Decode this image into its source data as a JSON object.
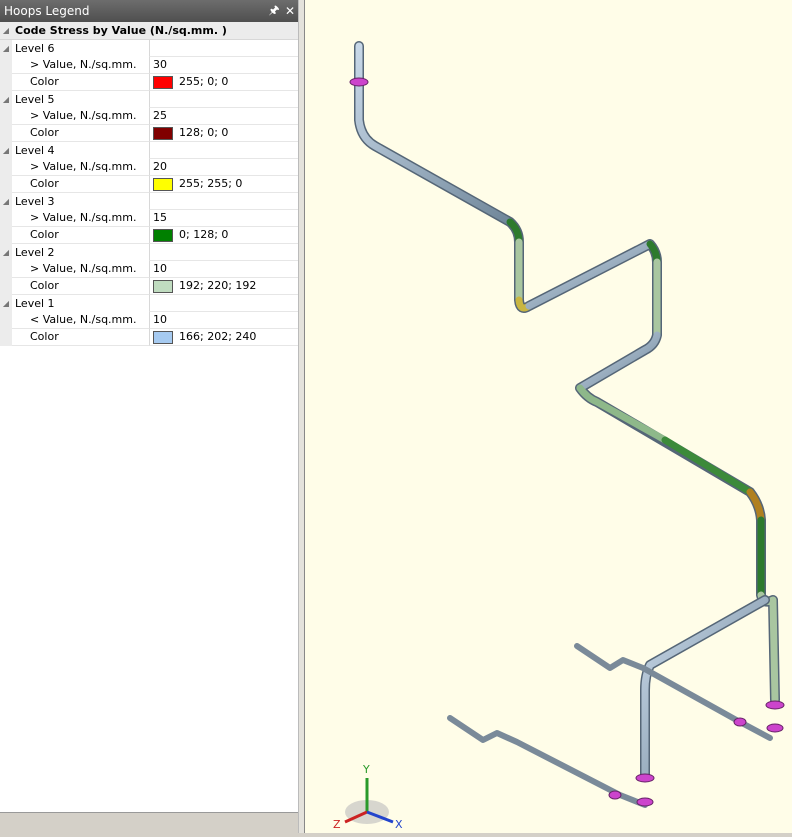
{
  "panel": {
    "title": "Hoops Legend",
    "pin_icon": "pin-icon",
    "close_icon": "close-icon",
    "header": "Code Stress by Value (N./sq.mm. )",
    "levels": [
      {
        "name": "Level 6",
        "cmp_label": "> Value, N./sq.mm.",
        "value": "30",
        "color_label": "Color",
        "color_text": "255; 0; 0",
        "color": "#ff0000"
      },
      {
        "name": "Level 5",
        "cmp_label": "> Value, N./sq.mm.",
        "value": "25",
        "color_label": "Color",
        "color_text": "128; 0; 0",
        "color": "#800000"
      },
      {
        "name": "Level 4",
        "cmp_label": "> Value, N./sq.mm.",
        "value": "20",
        "color_label": "Color",
        "color_text": "255; 255; 0",
        "color": "#ffff00"
      },
      {
        "name": "Level 3",
        "cmp_label": "> Value, N./sq.mm.",
        "value": "15",
        "color_label": "Color",
        "color_text": "0; 128; 0",
        "color": "#008000"
      },
      {
        "name": "Level 2",
        "cmp_label": "> Value, N./sq.mm.",
        "value": "10",
        "color_label": "Color",
        "color_text": "192; 220; 192",
        "color": "#c0dcc0"
      },
      {
        "name": "Level 1",
        "cmp_label": "< Value, N./sq.mm.",
        "value": "10",
        "color_label": "Color",
        "color_text": "166; 202; 240",
        "color": "#a6caf0"
      }
    ]
  },
  "view": {
    "axes": {
      "y": "Y",
      "z": "Z",
      "x": "X"
    }
  }
}
